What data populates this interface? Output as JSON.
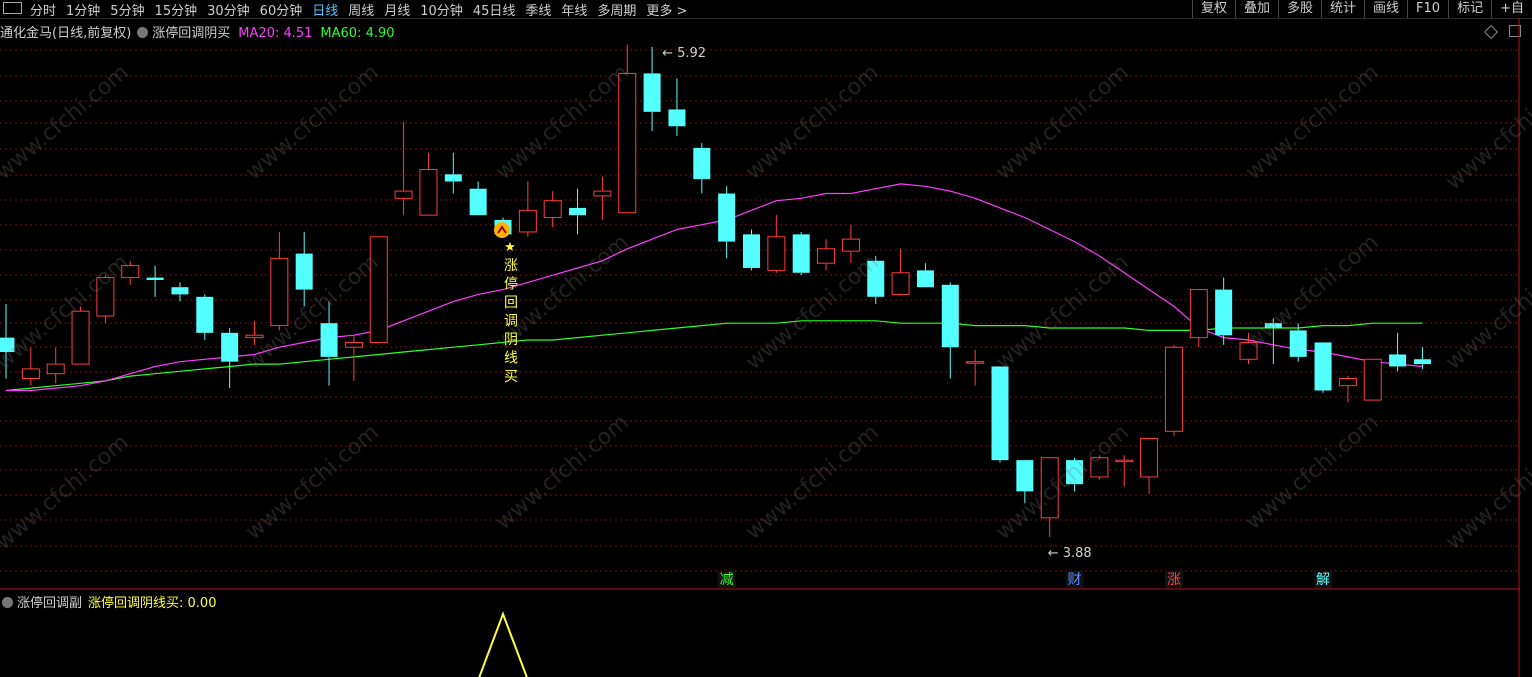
{
  "toolbar": {
    "periods": [
      "分时",
      "1分钟",
      "5分钟",
      "15分钟",
      "30分钟",
      "60分钟",
      "日线",
      "周线",
      "月线",
      "10分钟",
      "45日线",
      "季线",
      "年线",
      "多周期",
      "更多 >"
    ],
    "active_period": "日线",
    "right_buttons": [
      "复权",
      "叠加",
      "多股",
      "统计",
      "画线",
      "F10",
      "标记",
      "+自"
    ]
  },
  "info": {
    "stock": "通化金马(日线,前复权)",
    "indicator": "涨停回调阴买",
    "ma20_label": "MA20: 4.51",
    "ma60_label": "MA60: 4.90"
  },
  "subinfo": {
    "name": "涨停回调副",
    "value_label": "涨停回调阴线买: 0.00"
  },
  "watermark": "www.cfchi.com",
  "colors": {
    "up": "#ff3c3c",
    "down": "#54ffff",
    "ma20": "#ff3cff",
    "ma60": "#2cff2c",
    "signal": "#ffff3c",
    "grid": "#7a1010",
    "background": "#000000"
  },
  "chart_data": {
    "type": "candlestick",
    "price_range": [
      3.75,
      6.0
    ],
    "candles": [
      {
        "o": 4.71,
        "h": 4.85,
        "l": 4.54,
        "c": 4.65
      },
      {
        "o": 4.54,
        "h": 4.67,
        "l": 4.51,
        "c": 4.58
      },
      {
        "o": 4.56,
        "h": 4.67,
        "l": 4.52,
        "c": 4.6
      },
      {
        "o": 4.6,
        "h": 4.84,
        "l": 4.6,
        "c": 4.82
      },
      {
        "o": 4.8,
        "h": 4.97,
        "l": 4.77,
        "c": 4.96
      },
      {
        "o": 4.96,
        "h": 5.03,
        "l": 4.93,
        "c": 5.01
      },
      {
        "o": 4.96,
        "h": 5.01,
        "l": 4.88,
        "c": 4.95
      },
      {
        "o": 4.92,
        "h": 4.94,
        "l": 4.86,
        "c": 4.89
      },
      {
        "o": 4.88,
        "h": 4.89,
        "l": 4.7,
        "c": 4.73
      },
      {
        "o": 4.73,
        "h": 4.75,
        "l": 4.5,
        "c": 4.61
      },
      {
        "o": 4.71,
        "h": 4.78,
        "l": 4.68,
        "c": 4.72
      },
      {
        "o": 4.76,
        "h": 5.15,
        "l": 4.74,
        "c": 5.04
      },
      {
        "o": 5.06,
        "h": 5.15,
        "l": 4.84,
        "c": 4.91
      },
      {
        "o": 4.77,
        "h": 4.86,
        "l": 4.51,
        "c": 4.63
      },
      {
        "o": 4.67,
        "h": 4.72,
        "l": 4.53,
        "c": 4.69
      },
      {
        "o": 4.69,
        "h": 5.13,
        "l": 4.69,
        "c": 5.13
      },
      {
        "o": 5.29,
        "h": 5.61,
        "l": 5.22,
        "c": 5.32
      },
      {
        "o": 5.22,
        "h": 5.48,
        "l": 5.22,
        "c": 5.41
      },
      {
        "o": 5.39,
        "h": 5.48,
        "l": 5.31,
        "c": 5.36
      },
      {
        "o": 5.33,
        "h": 5.36,
        "l": 5.22,
        "c": 5.22
      },
      {
        "o": 5.2,
        "h": 5.21,
        "l": 5.13,
        "c": 5.14
      },
      {
        "o": 5.15,
        "h": 5.36,
        "l": 5.13,
        "c": 5.24
      },
      {
        "o": 5.21,
        "h": 5.32,
        "l": 5.17,
        "c": 5.28
      },
      {
        "o": 5.25,
        "h": 5.33,
        "l": 5.14,
        "c": 5.22
      },
      {
        "o": 5.3,
        "h": 5.38,
        "l": 5.2,
        "c": 5.32
      },
      {
        "o": 5.23,
        "h": 5.93,
        "l": 5.23,
        "c": 5.81
      },
      {
        "o": 5.81,
        "h": 5.92,
        "l": 5.57,
        "c": 5.65
      },
      {
        "o": 5.66,
        "h": 5.79,
        "l": 5.55,
        "c": 5.59
      },
      {
        "o": 5.5,
        "h": 5.52,
        "l": 5.31,
        "c": 5.37
      },
      {
        "o": 5.31,
        "h": 5.34,
        "l": 5.04,
        "c": 5.11
      },
      {
        "o": 5.14,
        "h": 5.16,
        "l": 4.99,
        "c": 5.0
      },
      {
        "o": 4.99,
        "h": 5.22,
        "l": 4.98,
        "c": 5.13
      },
      {
        "o": 5.14,
        "h": 5.15,
        "l": 4.97,
        "c": 4.98
      },
      {
        "o": 5.02,
        "h": 5.12,
        "l": 4.99,
        "c": 5.08
      },
      {
        "o": 5.07,
        "h": 5.18,
        "l": 5.02,
        "c": 5.12
      },
      {
        "o": 5.03,
        "h": 5.05,
        "l": 4.85,
        "c": 4.88
      },
      {
        "o": 4.89,
        "h": 5.08,
        "l": 4.89,
        "c": 4.98
      },
      {
        "o": 4.99,
        "h": 5.02,
        "l": 4.92,
        "c": 4.92
      },
      {
        "o": 4.93,
        "h": 4.94,
        "l": 4.54,
        "c": 4.67
      },
      {
        "o": 4.61,
        "h": 4.66,
        "l": 4.51,
        "c": 4.61
      },
      {
        "o": 4.59,
        "h": 4.59,
        "l": 4.19,
        "c": 4.2
      },
      {
        "o": 4.2,
        "h": 4.2,
        "l": 4.02,
        "c": 4.07
      },
      {
        "o": 3.96,
        "h": 4.2,
        "l": 3.88,
        "c": 4.21
      },
      {
        "o": 4.2,
        "h": 4.21,
        "l": 4.07,
        "c": 4.1
      },
      {
        "o": 4.13,
        "h": 4.22,
        "l": 4.12,
        "c": 4.21
      },
      {
        "o": 4.2,
        "h": 4.22,
        "l": 4.09,
        "c": 4.2
      },
      {
        "o": 4.13,
        "h": 4.25,
        "l": 4.06,
        "c": 4.29
      },
      {
        "o": 4.32,
        "h": 4.68,
        "l": 4.3,
        "c": 4.67
      },
      {
        "o": 4.71,
        "h": 4.89,
        "l": 4.67,
        "c": 4.91
      },
      {
        "o": 4.91,
        "h": 4.96,
        "l": 4.68,
        "c": 4.72
      },
      {
        "o": 4.62,
        "h": 4.73,
        "l": 4.6,
        "c": 4.69
      },
      {
        "o": 4.77,
        "h": 4.79,
        "l": 4.6,
        "c": 4.75
      },
      {
        "o": 4.74,
        "h": 4.77,
        "l": 4.61,
        "c": 4.63
      },
      {
        "o": 4.69,
        "h": 4.69,
        "l": 4.48,
        "c": 4.49
      },
      {
        "o": 4.51,
        "h": 4.55,
        "l": 4.44,
        "c": 4.54
      },
      {
        "o": 4.45,
        "h": 4.62,
        "l": 4.45,
        "c": 4.62
      },
      {
        "o": 4.64,
        "h": 4.73,
        "l": 4.57,
        "c": 4.59
      },
      {
        "o": 4.62,
        "h": 4.67,
        "l": 4.58,
        "c": 4.6
      }
    ],
    "ma20": [
      4.49,
      4.49,
      4.5,
      4.51,
      4.53,
      4.56,
      4.59,
      4.61,
      4.62,
      4.63,
      4.64,
      4.67,
      4.69,
      4.71,
      4.72,
      4.74,
      4.78,
      4.82,
      4.86,
      4.89,
      4.91,
      4.94,
      4.97,
      5.0,
      5.03,
      5.08,
      5.12,
      5.16,
      5.18,
      5.2,
      5.24,
      5.28,
      5.29,
      5.31,
      5.31,
      5.33,
      5.35,
      5.34,
      5.32,
      5.29,
      5.25,
      5.21,
      5.16,
      5.11,
      5.05,
      4.98,
      4.91,
      4.84,
      4.75,
      4.71,
      4.7,
      4.68,
      4.66,
      4.65,
      4.63,
      4.61,
      4.6,
      4.59
    ],
    "ma60": [
      4.49,
      4.5,
      4.51,
      4.52,
      4.53,
      4.55,
      4.56,
      4.57,
      4.58,
      4.59,
      4.6,
      4.6,
      4.61,
      4.62,
      4.63,
      4.64,
      4.65,
      4.66,
      4.67,
      4.68,
      4.69,
      4.7,
      4.7,
      4.71,
      4.72,
      4.73,
      4.74,
      4.75,
      4.76,
      4.77,
      4.77,
      4.77,
      4.78,
      4.78,
      4.78,
      4.78,
      4.77,
      4.77,
      4.77,
      4.76,
      4.76,
      4.76,
      4.75,
      4.75,
      4.75,
      4.75,
      4.74,
      4.74,
      4.74,
      4.75,
      4.75,
      4.75,
      4.75,
      4.76,
      4.76,
      4.77,
      4.77,
      4.77
    ],
    "annotations": {
      "high_label": "5.92",
      "low_label": "3.88",
      "high_index": 26,
      "low_index": 42
    },
    "signal": {
      "index": 20,
      "text": "涨停回调阴线买",
      "star": "★"
    },
    "event_markers": [
      {
        "index": 29,
        "text": "减",
        "color": "#2cff2c"
      },
      {
        "index": 43,
        "text": "财",
        "color": "#5a8cff"
      },
      {
        "index": 47,
        "text": "涨",
        "color": "#ff4040"
      },
      {
        "index": 53,
        "text": "解",
        "color": "#54ffff"
      }
    ],
    "sub_signal": [
      0,
      0,
      0,
      0,
      0,
      0,
      0,
      0,
      0,
      0,
      0,
      0,
      0,
      0,
      0,
      0,
      0,
      0,
      0,
      0,
      1,
      0,
      0,
      0,
      0,
      0,
      0,
      0,
      0,
      0,
      0,
      0,
      0,
      0,
      0,
      0,
      0,
      0,
      0,
      0,
      0,
      0,
      0,
      0,
      0,
      0,
      0,
      0,
      0,
      0,
      0,
      0,
      0,
      0,
      0,
      0,
      0,
      0
    ]
  }
}
